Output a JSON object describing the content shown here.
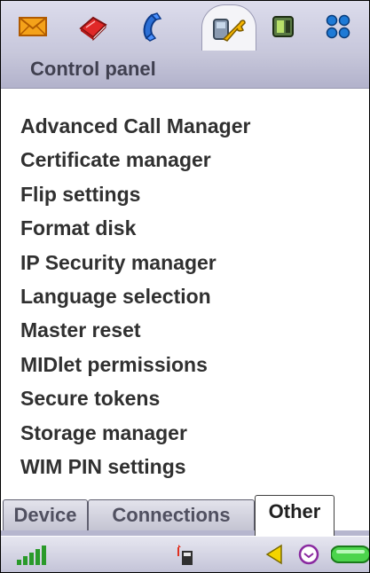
{
  "top_bar": {
    "apps": [
      {
        "icon": "envelope-icon"
      },
      {
        "icon": "book-icon"
      },
      {
        "icon": "phone-icon"
      },
      {
        "icon": "control-panel-icon",
        "active": true
      },
      {
        "icon": "phone-device-icon"
      },
      {
        "icon": "grid-icon"
      }
    ]
  },
  "title": "Control panel",
  "items": [
    "Advanced Call Manager",
    "Certificate manager",
    "Flip settings",
    "Format disk",
    "IP Security manager",
    "Language selection",
    "Master reset",
    "MIDlet permissions",
    "Secure tokens",
    "Storage manager",
    "WIM PIN settings"
  ],
  "tabs": {
    "device": "Device",
    "connections": "Connections",
    "other": "Other",
    "selected": "Other"
  },
  "status_bar": {
    "icons": [
      "signal-strength-icon",
      "sim-card-icon",
      "speaker-icon",
      "clock-icon",
      "battery-icon"
    ],
    "signal_level": 1.0,
    "battery_level": 1.0
  },
  "colors": {
    "accent": "#b6b6ce",
    "list_text": "#303030"
  }
}
